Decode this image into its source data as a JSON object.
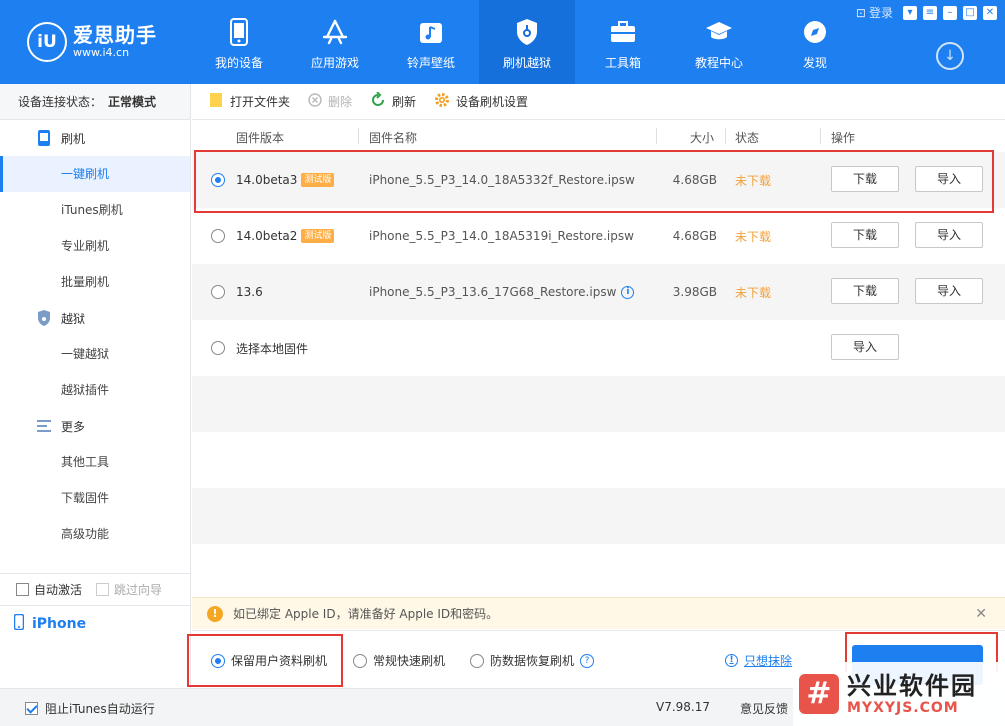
{
  "brand": {
    "name": "爱思助手",
    "url": "www.i4.cn",
    "mark": "iU"
  },
  "nav": [
    {
      "label": "我的设备",
      "icon": "phone-icon"
    },
    {
      "label": "应用游戏",
      "icon": "app-store-icon"
    },
    {
      "label": "铃声壁纸",
      "icon": "music-icon"
    },
    {
      "label": "刷机越狱",
      "icon": "shield-icon",
      "active": true
    },
    {
      "label": "工具箱",
      "icon": "toolbox-icon"
    },
    {
      "label": "教程中心",
      "icon": "graduation-cap-icon"
    },
    {
      "label": "发现",
      "icon": "compass-icon"
    }
  ],
  "window": {
    "login": "登录"
  },
  "sidebar": {
    "status_label": "设备连接状态：",
    "status_value": "正常模式",
    "groups": [
      {
        "label": "刷机",
        "icon": "phone-icon",
        "items": [
          "一键刷机",
          "iTunes刷机",
          "专业刷机",
          "批量刷机"
        ]
      },
      {
        "label": "越狱",
        "icon": "shield-icon",
        "items": [
          "一键越狱",
          "越狱插件"
        ]
      },
      {
        "label": "更多",
        "icon": "menu-icon",
        "items": [
          "其他工具",
          "下载固件",
          "高级功能"
        ]
      }
    ],
    "auto_activate": "自动激活",
    "skip_guide": "跳过向导",
    "device": "iPhone"
  },
  "toolbar": {
    "open_folder": "打开文件夹",
    "delete": "删除",
    "refresh": "刷新",
    "settings": "设备刷机设置"
  },
  "table": {
    "headers": {
      "version": "固件版本",
      "name": "固件名称",
      "size": "大小",
      "status": "状态",
      "action": "操作"
    },
    "rows": [
      {
        "version": "14.0beta3",
        "tag": "测试版",
        "name": "iPhone_5.5_P3_14.0_18A5332f_Restore.ipsw",
        "size": "4.68GB",
        "status": "未下载",
        "download": "下载",
        "import": "导入",
        "selected": true
      },
      {
        "version": "14.0beta2",
        "tag": "测试版",
        "name": "iPhone_5.5_P3_14.0_18A5319i_Restore.ipsw",
        "size": "4.68GB",
        "status": "未下载",
        "download": "下载",
        "import": "导入"
      },
      {
        "version": "13.6",
        "tag": "",
        "name": "iPhone_5.5_P3_13.6_17G68_Restore.ipsw",
        "size": "3.98GB",
        "status": "未下载",
        "download": "下载",
        "import": "导入"
      }
    ],
    "local": {
      "label": "选择本地固件",
      "import": "导入"
    }
  },
  "alert": {
    "text": "如已绑定 Apple ID，请准备好 Apple ID和密码。"
  },
  "modes": {
    "keep_data": "保留用户资料刷机",
    "quick": "常规快速刷机",
    "anti_recovery": "防数据恢复刷机",
    "erase_link": "只想抹除"
  },
  "statusbar": {
    "block_itunes": "阻止iTunes自动运行",
    "version": "V7.98.17",
    "feedback": "意见反馈"
  },
  "watermark": {
    "cn": "兴业软件园",
    "url": "MYXYJS.COM"
  },
  "colors": {
    "primary": "#1e7ff0",
    "status_orange": "#f2a13a",
    "highlight_red": "#e53935"
  }
}
